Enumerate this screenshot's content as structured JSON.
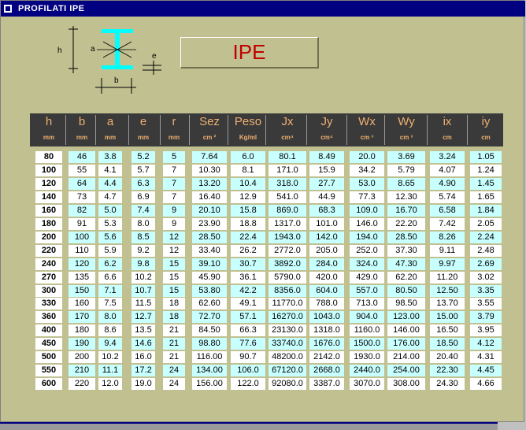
{
  "window": {
    "title": "PROFILATI  IPE"
  },
  "diagram_labels": {
    "h": "h",
    "a": "a",
    "e": "e",
    "b": "b"
  },
  "title_box": {
    "text": "IPE"
  },
  "colors": {
    "titlebar": "#000080",
    "background": "#c0c090",
    "header_bg": "#3a3a3a",
    "header_text": "#f0b070",
    "cell_cyan": "#c8ffff",
    "title_text": "#c00000"
  },
  "columns": [
    {
      "sym": "h",
      "unit": "mm"
    },
    {
      "sym": "b",
      "unit": "mm"
    },
    {
      "sym": "a",
      "unit": "mm"
    },
    {
      "sym": "e",
      "unit": "mm"
    },
    {
      "sym": "r",
      "unit": "mm"
    },
    {
      "sym": "Sez",
      "unit": "cm ²"
    },
    {
      "sym": "Peso",
      "unit": "Kg/ml"
    },
    {
      "sym": "Jx",
      "unit": "cm⁴"
    },
    {
      "sym": "Jy",
      "unit": "cm⁴"
    },
    {
      "sym": "Wx",
      "unit": "cm ³"
    },
    {
      "sym": "Wy",
      "unit": "cm ³"
    },
    {
      "sym": "ix",
      "unit": "cm"
    },
    {
      "sym": "iy",
      "unit": "cm"
    }
  ],
  "rows": [
    [
      "80",
      "46",
      "3.8",
      "5.2",
      "5",
      "7.64",
      "6.0",
      "80.1",
      "8.49",
      "20.0",
      "3.69",
      "3.24",
      "1.05"
    ],
    [
      "100",
      "55",
      "4.1",
      "5.7",
      "7",
      "10.30",
      "8.1",
      "171.0",
      "15.9",
      "34.2",
      "5.79",
      "4.07",
      "1.24"
    ],
    [
      "120",
      "64",
      "4.4",
      "6.3",
      "7",
      "13.20",
      "10.4",
      "318.0",
      "27.7",
      "53.0",
      "8.65",
      "4.90",
      "1.45"
    ],
    [
      "140",
      "73",
      "4.7",
      "6.9",
      "7",
      "16.40",
      "12.9",
      "541.0",
      "44.9",
      "77.3",
      "12.30",
      "5.74",
      "1.65"
    ],
    [
      "160",
      "82",
      "5.0",
      "7.4",
      "9",
      "20.10",
      "15.8",
      "869.0",
      "68.3",
      "109.0",
      "16.70",
      "6.58",
      "1.84"
    ],
    [
      "180",
      "91",
      "5.3",
      "8.0",
      "9",
      "23.90",
      "18.8",
      "1317.0",
      "101.0",
      "146.0",
      "22.20",
      "7.42",
      "2.05"
    ],
    [
      "200",
      "100",
      "5.6",
      "8.5",
      "12",
      "28.50",
      "22.4",
      "1943.0",
      "142.0",
      "194.0",
      "28.50",
      "8.26",
      "2.24"
    ],
    [
      "220",
      "110",
      "5.9",
      "9.2",
      "12",
      "33.40",
      "26.2",
      "2772.0",
      "205.0",
      "252.0",
      "37.30",
      "9.11",
      "2.48"
    ],
    [
      "240",
      "120",
      "6.2",
      "9.8",
      "15",
      "39.10",
      "30.7",
      "3892.0",
      "284.0",
      "324.0",
      "47.30",
      "9.97",
      "2.69"
    ],
    [
      "270",
      "135",
      "6.6",
      "10.2",
      "15",
      "45.90",
      "36.1",
      "5790.0",
      "420.0",
      "429.0",
      "62.20",
      "11.20",
      "3.02"
    ],
    [
      "300",
      "150",
      "7.1",
      "10.7",
      "15",
      "53.80",
      "42.2",
      "8356.0",
      "604.0",
      "557.0",
      "80.50",
      "12.50",
      "3.35"
    ],
    [
      "330",
      "160",
      "7.5",
      "11.5",
      "18",
      "62.60",
      "49.1",
      "11770.0",
      "788.0",
      "713.0",
      "98.50",
      "13.70",
      "3.55"
    ],
    [
      "360",
      "170",
      "8.0",
      "12.7",
      "18",
      "72.70",
      "57.1",
      "16270.0",
      "1043.0",
      "904.0",
      "123.00",
      "15.00",
      "3.79"
    ],
    [
      "400",
      "180",
      "8.6",
      "13.5",
      "21",
      "84.50",
      "66.3",
      "23130.0",
      "1318.0",
      "1160.0",
      "146.00",
      "16.50",
      "3.95"
    ],
    [
      "450",
      "190",
      "9.4",
      "14.6",
      "21",
      "98.80",
      "77.6",
      "33740.0",
      "1676.0",
      "1500.0",
      "176.00",
      "18.50",
      "4.12"
    ],
    [
      "500",
      "200",
      "10.2",
      "16.0",
      "21",
      "116.00",
      "90.7",
      "48200.0",
      "2142.0",
      "1930.0",
      "214.00",
      "20.40",
      "4.31"
    ],
    [
      "550",
      "210",
      "11.1",
      "17.2",
      "24",
      "134.00",
      "106.0",
      "67120.0",
      "2668.0",
      "2440.0",
      "254.00",
      "22.30",
      "4.45"
    ],
    [
      "600",
      "220",
      "12.0",
      "19.0",
      "24",
      "156.00",
      "122.0",
      "92080.0",
      "3387.0",
      "3070.0",
      "308.00",
      "24.30",
      "4.66"
    ]
  ]
}
